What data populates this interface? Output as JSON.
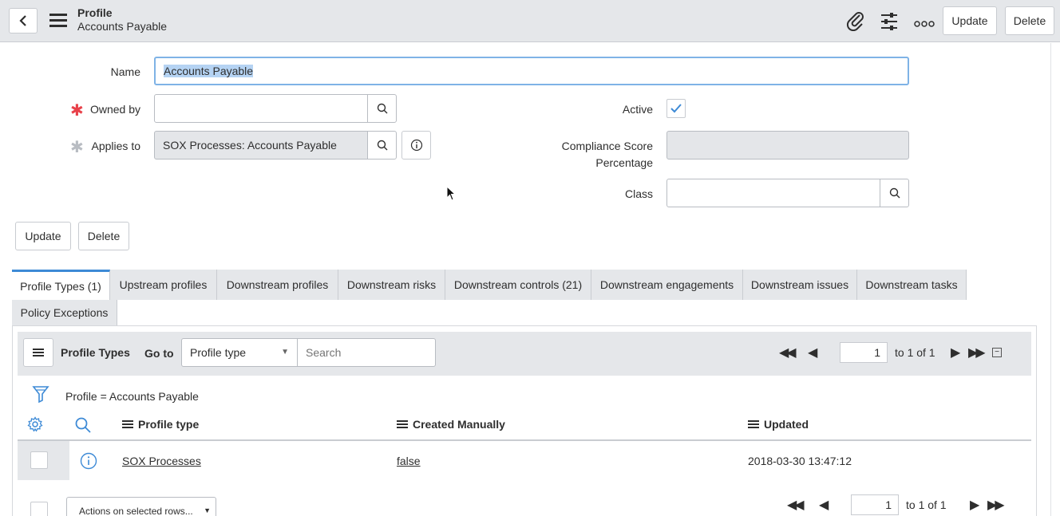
{
  "header": {
    "title": "Profile",
    "subtitle": "Accounts Payable",
    "update_label": "Update",
    "delete_label": "Delete"
  },
  "form": {
    "name_label": "Name",
    "name_value": "Accounts Payable",
    "owned_by_label": "Owned by",
    "owned_by_value": "",
    "applies_to_label": "Applies to",
    "applies_to_value": "SOX Processes: Accounts Payable",
    "active_label": "Active",
    "active_checked": true,
    "compliance_label_1": "Compliance Score",
    "compliance_label_2": "Percentage",
    "compliance_value": "",
    "class_label": "Class",
    "class_value": "",
    "update_label": "Update",
    "delete_label": "Delete"
  },
  "tabs": [
    {
      "label": "Profile Types (1)"
    },
    {
      "label": "Upstream profiles"
    },
    {
      "label": "Downstream profiles"
    },
    {
      "label": "Downstream risks"
    },
    {
      "label": "Downstream controls (21)"
    },
    {
      "label": "Downstream engagements"
    },
    {
      "label": "Downstream issues"
    },
    {
      "label": "Downstream tasks"
    },
    {
      "label": "Policy Exceptions"
    }
  ],
  "related_list": {
    "title": "Profile Types",
    "goto_label": "Go to",
    "goto_select": "Profile type",
    "search_placeholder": "Search",
    "page_value": "1",
    "page_range": "to 1 of 1",
    "filter_text": "Profile = Accounts Payable",
    "columns": [
      "Profile type",
      "Created Manually",
      "Updated"
    ],
    "rows": [
      {
        "profile_type": "SOX Processes",
        "created_manually": "false",
        "updated": "2018-03-30 13:47:12"
      }
    ],
    "actions_select": "Actions on selected rows..."
  },
  "colors": {
    "header_bg": "#e5e7ea",
    "accent": "#3d8ad6",
    "required": "#e8414a",
    "selection": "#b5d3f3"
  }
}
